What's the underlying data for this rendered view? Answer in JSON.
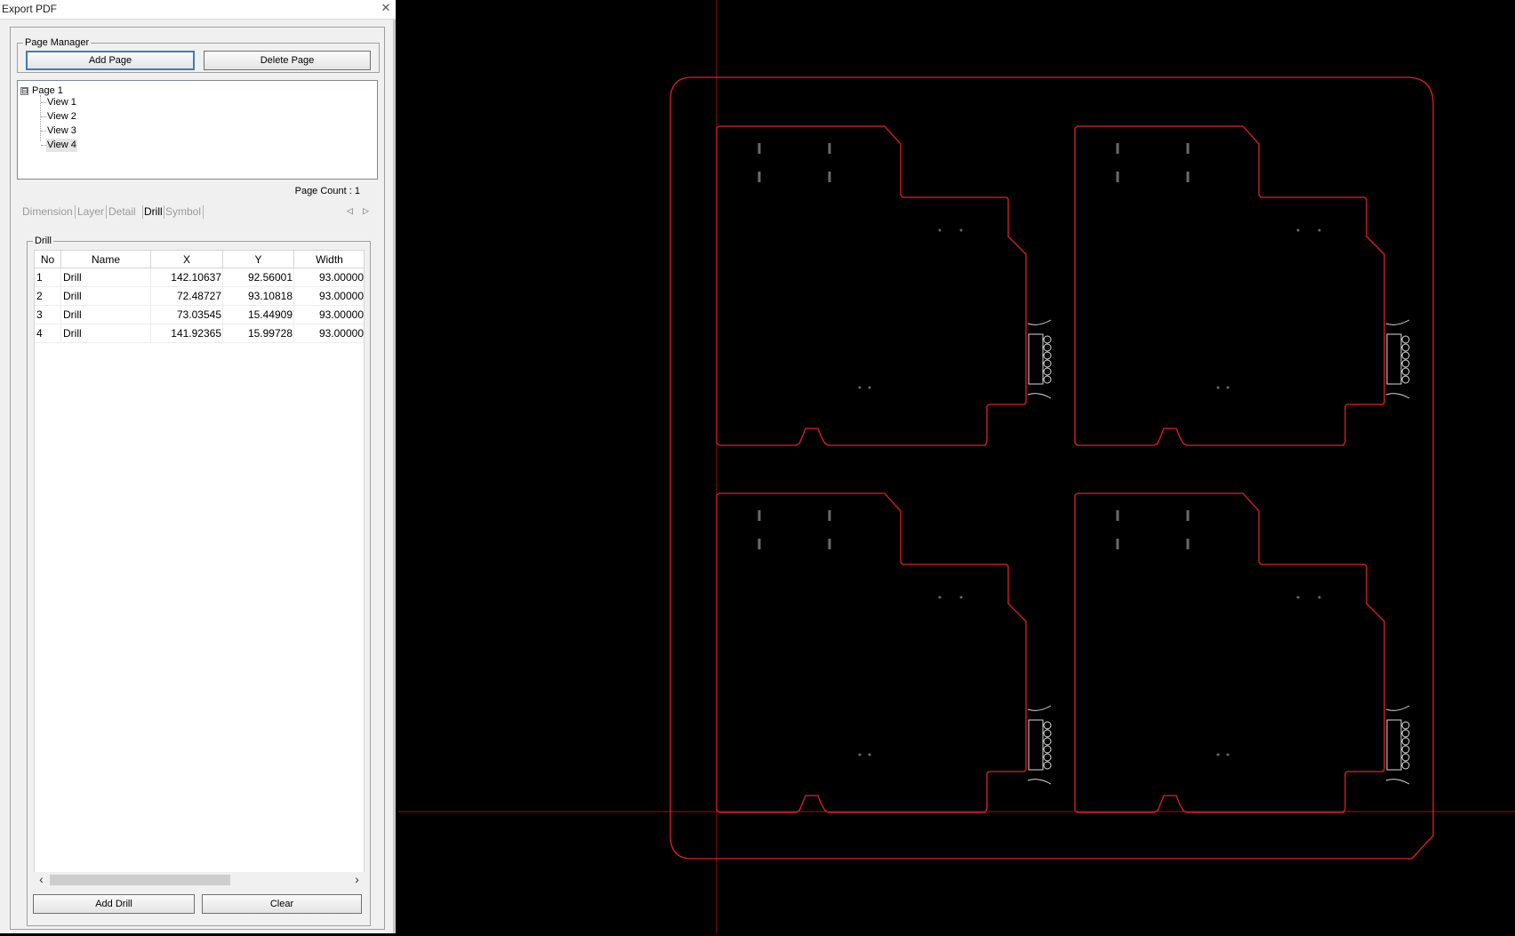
{
  "window": {
    "title": "Export PDF"
  },
  "page_manager": {
    "legend": "Page Manager",
    "add_page": "Add Page",
    "delete_page": "Delete Page",
    "tree": {
      "root_toggle": "⊟",
      "root": "Page 1",
      "views": [
        "View 1",
        "View 2",
        "View 3",
        "View 4"
      ],
      "selected": "View 4"
    },
    "page_count": "Page Count : 1"
  },
  "tabs": {
    "items": [
      "Dimension",
      "Layer",
      "Detail",
      "Drill",
      "Symbol"
    ],
    "active": "Drill",
    "prev_arrow": "◁",
    "next_arrow": "▷"
  },
  "drill": {
    "legend": "Drill",
    "columns": [
      "No",
      "Name",
      "X",
      "Y",
      "Width"
    ],
    "rows": [
      [
        "1",
        "Drill",
        "142.10637",
        "92.56001",
        "93.00000"
      ],
      [
        "2",
        "Drill",
        "72.48727",
        "93.10818",
        "93.00000"
      ],
      [
        "3",
        "Drill",
        "73.03545",
        "15.44909",
        "93.00000"
      ],
      [
        "4",
        "Drill",
        "141.92365",
        "15.99728",
        "93.00000"
      ]
    ],
    "scroll_left": "‹",
    "scroll_right": "›",
    "add_drill": "Add Drill",
    "clear": "Clear"
  },
  "colors": {
    "outline": "#e0202a",
    "crosshair": "#a01010",
    "background": "#000000",
    "feature": "#d8d8d8"
  }
}
